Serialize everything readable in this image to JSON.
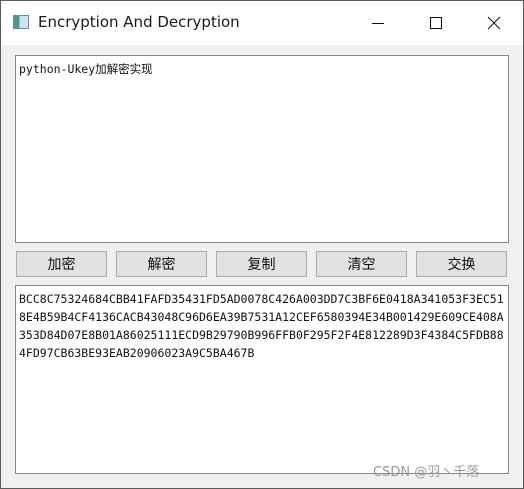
{
  "window": {
    "title": "Encryption And Decryption",
    "icon": "app-window-icon"
  },
  "input": {
    "value": "python-Ukey加解密实现"
  },
  "buttons": {
    "encrypt": "加密",
    "decrypt": "解密",
    "copy": "复制",
    "clear": "清空",
    "swap": "交换"
  },
  "output": {
    "value": "BCC8C75324684CBB41FAFD35431FD5AD0078C426A003DD7C3BF6E0418A341053F3EC518E4B59B4CF4136CACB43048C96D6EA39B7531A12CEF6580394E34B001429E609CE408A353D84D07E8B01A86025111ECD9B29790B996FFB0F295F2F4E812289D3F4384C5FDB884FD97CB63BE93EAB20906023A9C5BA467B"
  },
  "watermark": "CSDN @羽丶千落"
}
